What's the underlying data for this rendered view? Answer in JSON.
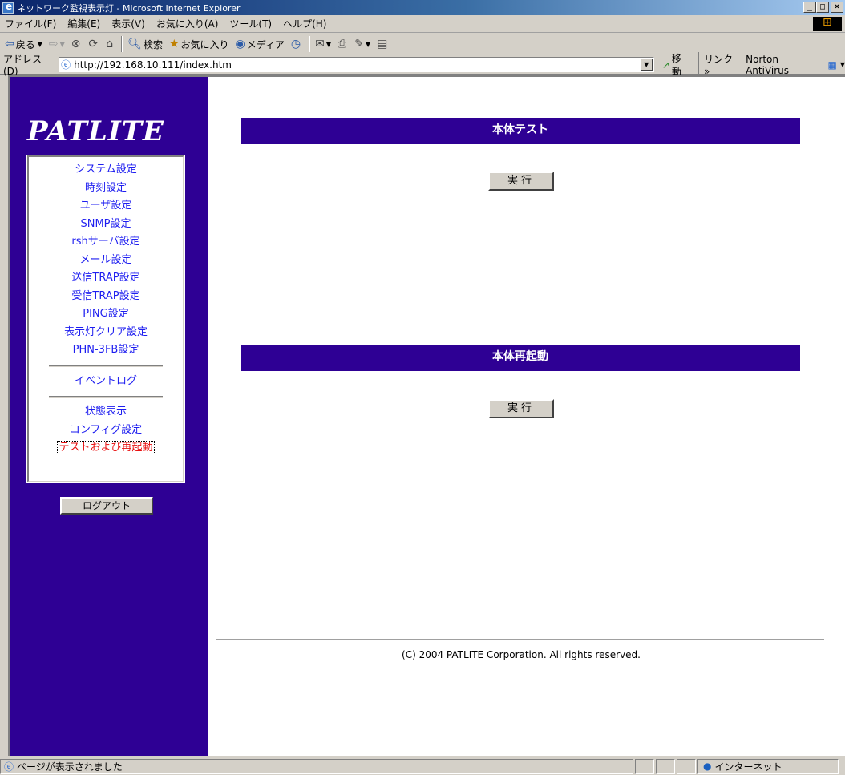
{
  "window": {
    "title": "ネットワーク監視表示灯 - Microsoft Internet Explorer",
    "min": "_",
    "max": "□",
    "close": "×"
  },
  "menu": [
    "ファイル(F)",
    "編集(E)",
    "表示(V)",
    "お気に入り(A)",
    "ツール(T)",
    "ヘルプ(H)"
  ],
  "toolbar": {
    "back": "戻る",
    "search": "検索",
    "favorites": "お気に入り",
    "media": "メディア"
  },
  "address": {
    "label": "アドレス(D)",
    "url": "http://192.168.10.111/index.htm",
    "go": "移動",
    "links": "リンク »",
    "norton": "Norton AntiVirus"
  },
  "sidebar": {
    "logo": "PATLITE",
    "settings": [
      "システム設定",
      "時刻設定",
      "ユーザ設定",
      "SNMP設定",
      "rshサーバ設定",
      "メール設定",
      "送信TRAP設定",
      "受信TRAP設定",
      "PING設定",
      "表示灯クリア設定",
      "PHN-3FB設定"
    ],
    "event_log": "イベントログ",
    "status": "状態表示",
    "config": "コンフィグ設定",
    "test_reboot": "テストおよび再起動",
    "logout": "ログアウト"
  },
  "main": {
    "test_title": "本体テスト",
    "test_button": "実行",
    "reboot_title": "本体再起動",
    "reboot_button": "実行",
    "copyright": "(C) 2004 PATLITE Corporation. All rights reserved."
  },
  "status": {
    "message": "ページが表示されました",
    "zone": "インターネット"
  }
}
